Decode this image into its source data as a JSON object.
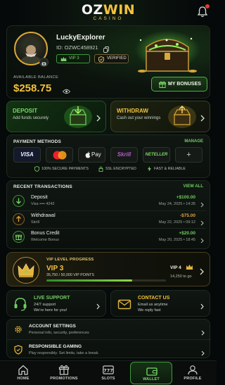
{
  "header": {
    "logo_main_a": "OZ",
    "logo_main_b": "WIN",
    "logo_sub": "CASINO",
    "icons": [
      "bell-icon"
    ]
  },
  "profile": {
    "username": "LuckyExplorer",
    "user_id": "ID: OZWC458921",
    "vip_badge": "VIP 3",
    "verified_badge": "VERIFIED",
    "balance_label": "AVAILABLE BALANCE",
    "balance": "$258.75",
    "bonus_button": "MY BONUSES"
  },
  "actions": {
    "deposit": {
      "title": "DEPOSIT",
      "subtitle": "Add funds securely"
    },
    "withdraw": {
      "title": "WITHDRAW",
      "subtitle": "Cash out your winnings"
    }
  },
  "payment": {
    "title": "PAYMENT METHODS",
    "manage": "MANAGE",
    "methods": [
      "VISA",
      "",
      "Pay",
      "Skrill",
      "NETELLER",
      "+"
    ],
    "features": [
      "100% SECURE PAYMENTS",
      "SSL ENCRYPTED",
      "FAST & RELIABLE"
    ]
  },
  "transactions": {
    "title": "RECENT TRANSACTIONS",
    "view_all": "VIEW ALL",
    "items": [
      {
        "name": "Deposit",
        "sub": "Visa •••• 4242",
        "amount": "+$100.00",
        "date": "May 24, 2025 • 14:35",
        "kind": "in"
      },
      {
        "name": "Withdrawal",
        "sub": "Skrill",
        "amount": "-$75.00",
        "date": "May 22, 2025 • 09:12",
        "kind": "out"
      },
      {
        "name": "Bonus Credit",
        "sub": "Welcome Bonus",
        "amount": "+$20.00",
        "date": "May 20, 2025 • 18:45",
        "kind": "in"
      }
    ]
  },
  "vip": {
    "title": "VIP LEVEL PROGRESS",
    "level": "VIP 3",
    "points": "35,750 / 50,000 VIP POINTS",
    "progress": 0.715,
    "next_level": "VIP 4",
    "to_go": "14,250 to go"
  },
  "support": {
    "live": {
      "title": "LIVE SUPPORT",
      "line1": "24/7 support",
      "line2": "We're here for you!"
    },
    "contact": {
      "title": "CONTACT US",
      "line1": "Email us anytime",
      "line2": "We reply fast"
    }
  },
  "settings": [
    {
      "title": "ACCOUNT SETTINGS",
      "sub": "Personal info, security, preferences"
    },
    {
      "title": "RESPONSIBLE GAMING",
      "sub": "Play responsibly. Set limits, take a break."
    }
  ],
  "nav": [
    {
      "label": "HOME",
      "icon": "home-icon"
    },
    {
      "label": "PROMOTIONS",
      "icon": "gift-icon"
    },
    {
      "label": "SLOTS",
      "icon": "slots-icon"
    },
    {
      "label": "WALLET",
      "icon": "wallet-icon",
      "active": true
    },
    {
      "label": "PROFILE",
      "icon": "profile-icon"
    }
  ],
  "colors": {
    "accent_green": "#6fcd60",
    "accent_gold": "#f4c23a",
    "background": "#06090a"
  }
}
